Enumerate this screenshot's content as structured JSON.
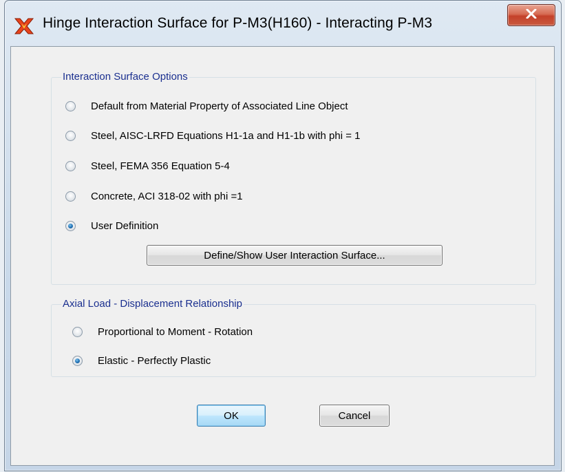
{
  "window": {
    "title": "Hinge Interaction Surface for P-M3(H160) - Interacting P-M3",
    "app_icon": "sap2000-app-icon",
    "close_icon": "close-x-icon"
  },
  "interaction_group": {
    "title": "Interaction Surface Options",
    "options": [
      {
        "label": "Default from Material Property of Associated Line Object",
        "checked": false
      },
      {
        "label": "Steel, AISC-LRFD Equations H1-1a and H1-1b with phi = 1",
        "checked": false
      },
      {
        "label": "Steel, FEMA 356 Equation 5-4",
        "checked": false
      },
      {
        "label": "Concrete,  ACI 318-02 with phi =1",
        "checked": false
      },
      {
        "label": "User Definition",
        "checked": true
      }
    ],
    "define_button": "Define/Show User Interaction Surface..."
  },
  "axial_group": {
    "title": "Axial Load - Displacement Relationship",
    "options": [
      {
        "label": "Proportional to Moment - Rotation",
        "checked": false
      },
      {
        "label": "Elastic - Perfectly Plastic",
        "checked": true
      }
    ]
  },
  "buttons": {
    "ok": "OK",
    "cancel": "Cancel"
  },
  "colors": {
    "group_title": "#1a2f8f",
    "close_button": "#c4412a"
  }
}
